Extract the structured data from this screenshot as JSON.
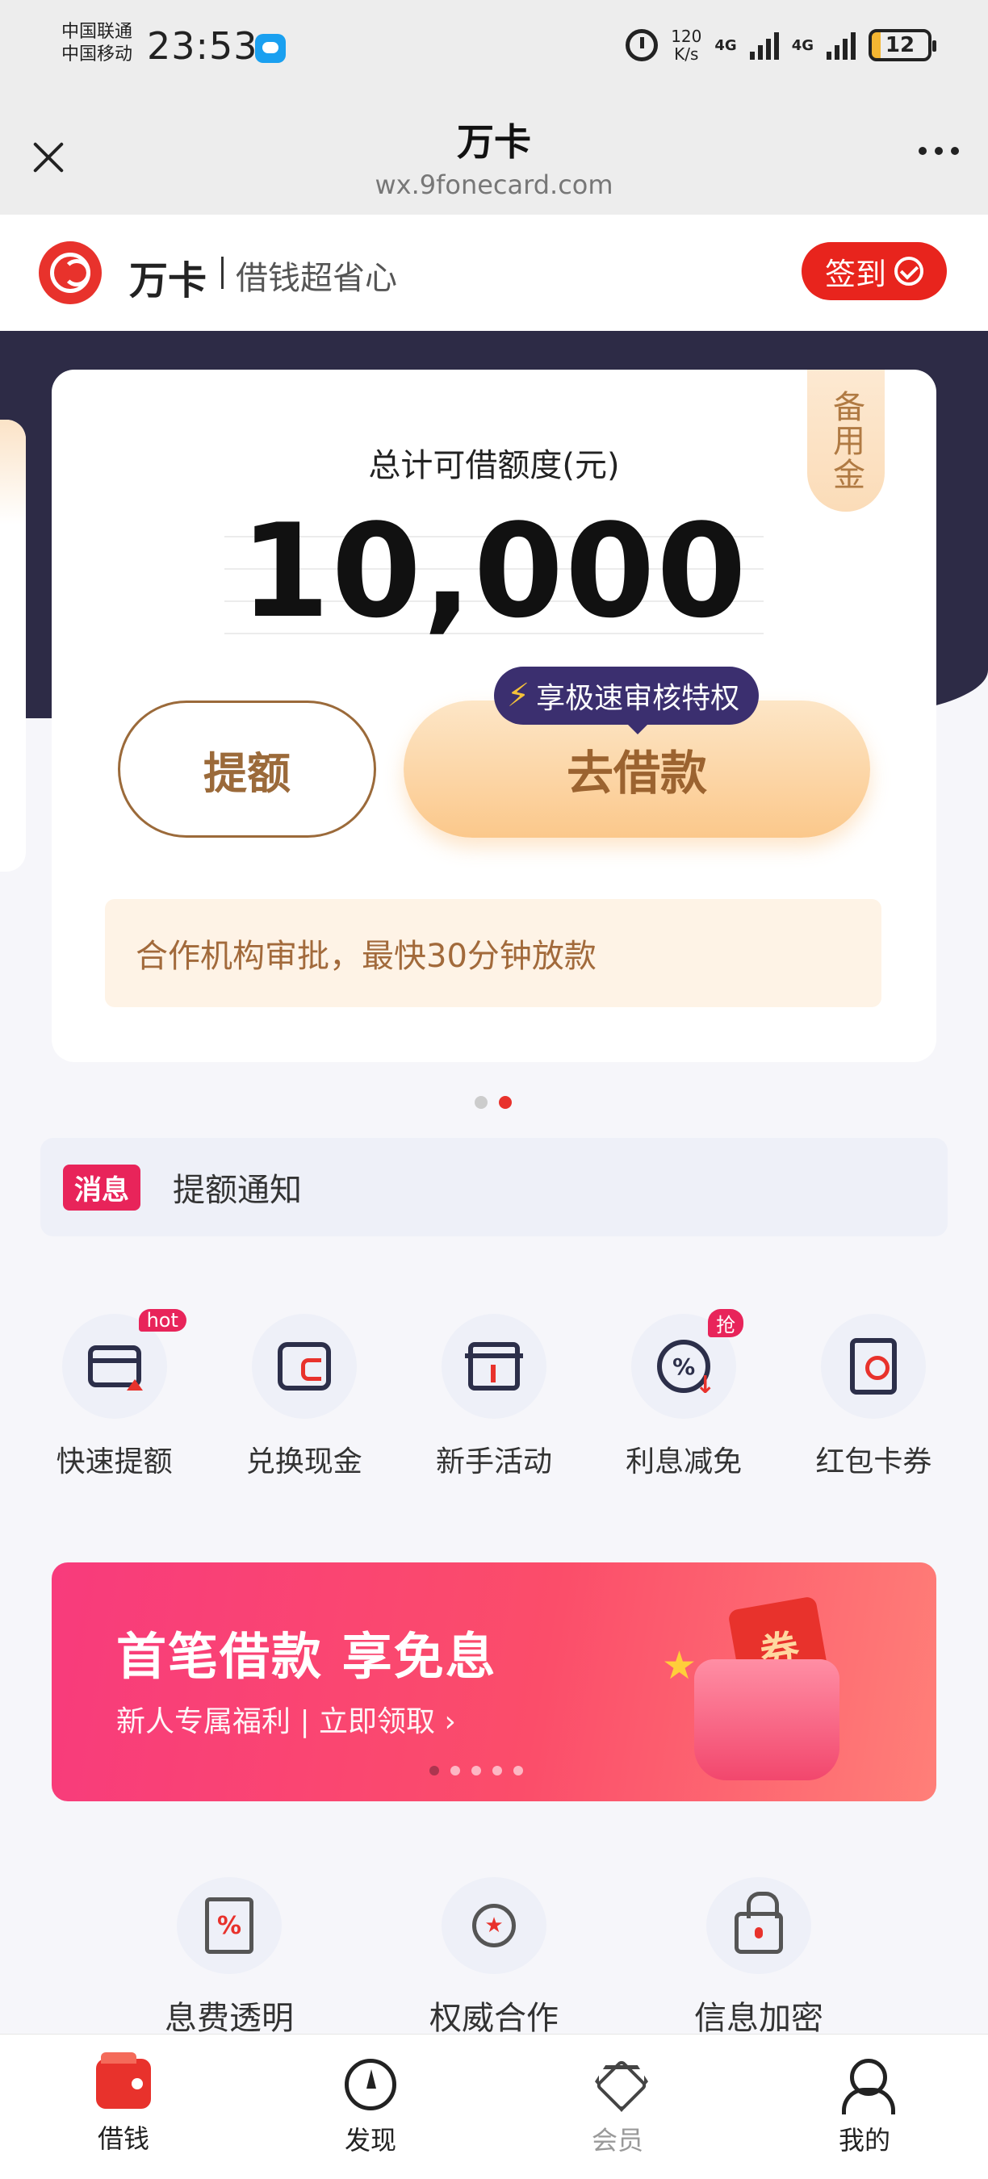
{
  "status_bar": {
    "carrier_1": "中国联通",
    "carrier_2": "中国移动",
    "time": "23:53",
    "net_speed_value": "120",
    "net_speed_unit": "K/s",
    "net_type_1": "4G",
    "net_type_2": "4G",
    "battery": "12"
  },
  "title_bar": {
    "title": "万卡",
    "url": "wx.9fonecard.com"
  },
  "brand": {
    "name": "万卡",
    "slogan": "借钱超省心",
    "signin_label": "签到",
    "accent_color": "#e8322c"
  },
  "card": {
    "reserve_tag": "备用金",
    "limit_label": "总计可借额度(元)",
    "limit_amount": "10,000",
    "raise_button": "提额",
    "borrow_button": "去借款",
    "fast_badge": "享极速审核特权",
    "notice": "合作机构审批，最快30分钟放款"
  },
  "carousel": {
    "count": 2,
    "active_index": 1
  },
  "message": {
    "tag": "消息",
    "text": "提额通知"
  },
  "quick_actions": [
    {
      "label": "快速提额",
      "badge": "hot",
      "icon": "card-raise-icon"
    },
    {
      "label": "兑换现金",
      "badge": "",
      "icon": "wallet-icon"
    },
    {
      "label": "新手活动",
      "badge": "",
      "icon": "gift-icon"
    },
    {
      "label": "利息减免",
      "badge": "抢",
      "icon": "rate-discount-icon"
    },
    {
      "label": "红包卡券",
      "badge": "",
      "icon": "coupon-icon"
    }
  ],
  "promo": {
    "title": "首笔借款 享免息",
    "subtitle": "新人专属福利 | 立即领取  ›",
    "ticket_text": "券",
    "page_count": 5,
    "active_index": 0
  },
  "features": [
    {
      "label": "息费透明",
      "icon": "percent-doc-icon"
    },
    {
      "label": "权威合作",
      "icon": "award-icon"
    },
    {
      "label": "信息加密",
      "icon": "lock-icon"
    }
  ],
  "tabs": [
    {
      "label": "借钱",
      "icon": "wallet-tab-icon",
      "active": true
    },
    {
      "label": "发现",
      "icon": "compass-icon",
      "active": false
    },
    {
      "label": "会员",
      "icon": "diamond-icon",
      "active": false
    },
    {
      "label": "我的",
      "icon": "user-icon",
      "active": false
    }
  ]
}
